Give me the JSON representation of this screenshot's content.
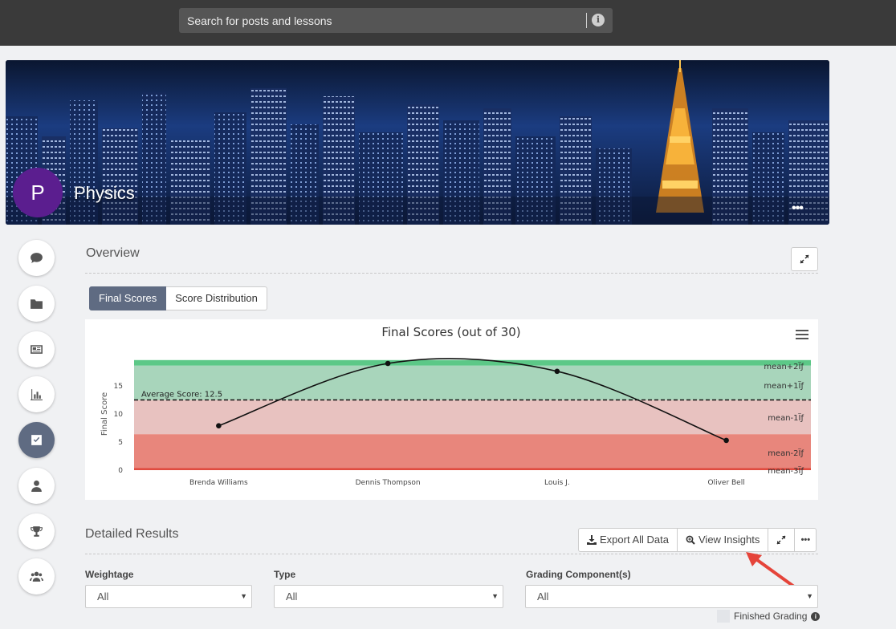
{
  "search": {
    "placeholder": "Search for posts and lessons",
    "info_icon": "info-icon"
  },
  "course": {
    "avatar_letter": "P",
    "title": "Physics",
    "avatar_color": "#5b1e8f",
    "more_label": "•••"
  },
  "nav": {
    "items": [
      {
        "name": "discussions",
        "icon": "comment-icon"
      },
      {
        "name": "files",
        "icon": "folder-icon"
      },
      {
        "name": "news",
        "icon": "newspaper-icon"
      },
      {
        "name": "reports",
        "icon": "bar-chart-icon"
      },
      {
        "name": "grades",
        "icon": "check-square-icon",
        "active": true
      },
      {
        "name": "users",
        "icon": "user-icon"
      },
      {
        "name": "achievements",
        "icon": "trophy-icon"
      },
      {
        "name": "groups",
        "icon": "group-icon"
      }
    ]
  },
  "overview": {
    "title": "Overview",
    "tabs": [
      {
        "label": "Final Scores",
        "active": true
      },
      {
        "label": "Score Distribution",
        "active": false
      }
    ]
  },
  "chart_data": {
    "type": "line",
    "title": "Final Scores (out of 30)",
    "ylabel": "Final Score",
    "xlabel": "",
    "categories": [
      "Brenda Williams",
      "Dennis Thompson",
      "Louis J.",
      "Oliver Bell"
    ],
    "values": [
      7.9,
      19,
      17.6,
      5.3
    ],
    "ylim": [
      0,
      20
    ],
    "yticks": [
      0,
      5,
      10,
      15
    ],
    "average": {
      "label": "Average Score: 12.5",
      "value": 12.5
    },
    "bands": [
      {
        "label": "mean+2Ïƒ",
        "from": 18.6,
        "to": 19.6,
        "color": "#5cc887"
      },
      {
        "label": "mean+1Ïƒ",
        "from": 12.5,
        "to": 18.6,
        "color": "#a8d5bb"
      },
      {
        "label": "mean-1Ïƒ",
        "from": 6.4,
        "to": 12.5,
        "color": "#e8c2c0"
      },
      {
        "label": "mean-2Ïƒ",
        "from": 0.4,
        "to": 6.4,
        "color": "#e8867c"
      },
      {
        "label": "mean-3Ïƒ",
        "from": 0,
        "to": 0.4,
        "color": "#e04b3f"
      }
    ],
    "grid": false,
    "legend": "none"
  },
  "detailed": {
    "title": "Detailed Results",
    "export_label": "Export All Data",
    "insights_label": "View Insights",
    "more_label": "•••",
    "filters": [
      {
        "label": "Weightage",
        "value": "All"
      },
      {
        "label": "Type",
        "value": "All"
      },
      {
        "label": "Grading Component(s)",
        "value": "All"
      }
    ],
    "finished_label": "Finished Grading"
  }
}
